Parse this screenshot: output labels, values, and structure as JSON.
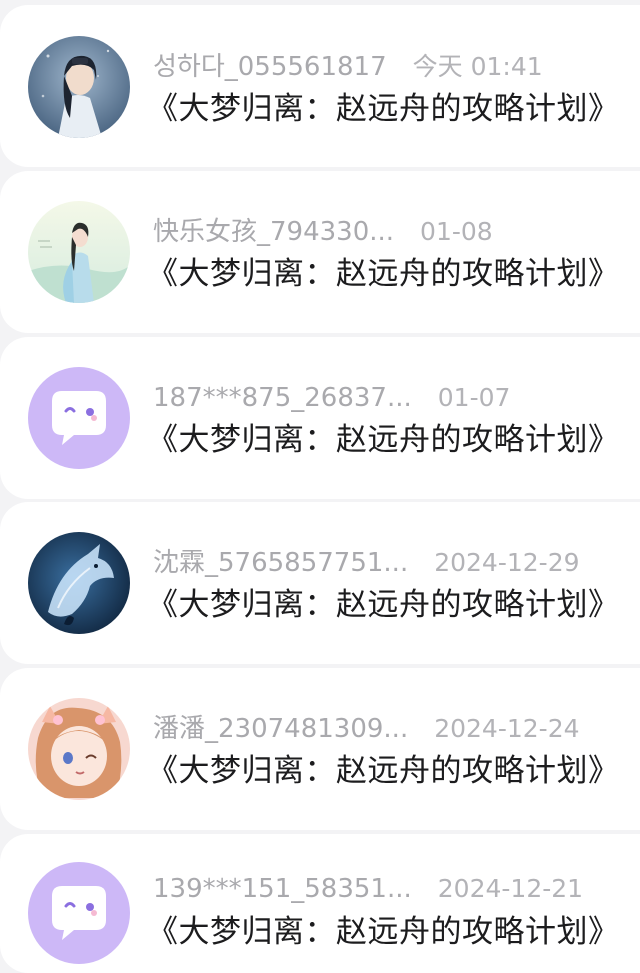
{
  "messages": [
    {
      "name": "성하다_055561817",
      "time": "今天 01:41",
      "title": "《大梦归离：赵远舟的攻略计划》",
      "avatar": "avatar-anime-man"
    },
    {
      "name": "快乐女孩_794330...",
      "time": "01-08",
      "title": "《大梦归离：赵远舟的攻略计划》",
      "avatar": "avatar-woman-hanfu"
    },
    {
      "name": "187***875_26837...",
      "time": "01-07",
      "title": "《大梦归离：赵远舟的攻略计划》",
      "avatar": "default-chat-avatar"
    },
    {
      "name": "沈霖_5765857751...",
      "time": "2024-12-29",
      "title": "《大梦归离：赵远舟的攻略计划》",
      "avatar": "avatar-wolf"
    },
    {
      "name": "潘潘_2307481309...",
      "time": "2024-12-24",
      "title": "《大梦归离：赵远舟的攻略计划》",
      "avatar": "avatar-anime-girl"
    },
    {
      "name": "139***151_58351...",
      "time": "2024-12-21",
      "title": "《大梦归离：赵远舟的攻略计划》",
      "avatar": "default-chat-avatar"
    }
  ],
  "colors": {
    "default_avatar_bg": "#cdb8f7",
    "name_text": "#a9a9ad",
    "title_text": "#1c1c1e"
  }
}
